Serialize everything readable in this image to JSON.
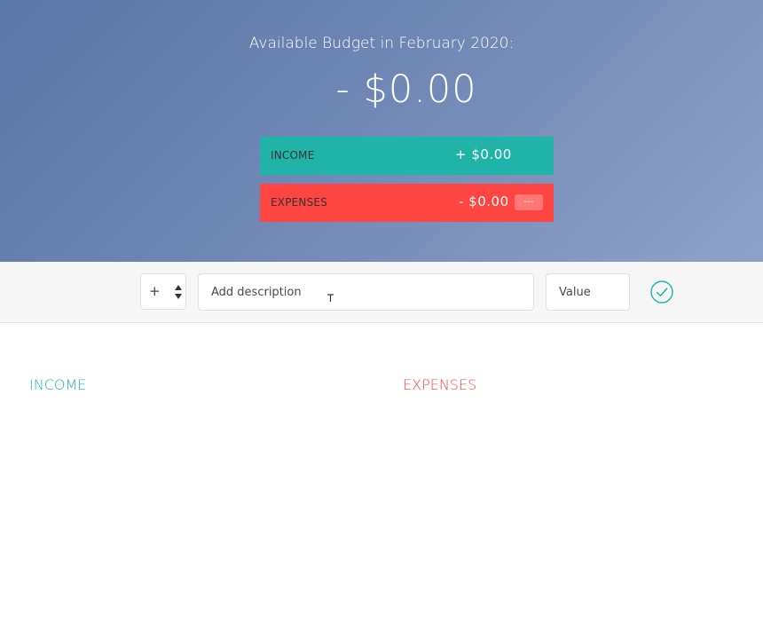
{
  "header": {
    "title": "Available Budget in February 2020:",
    "budget": "- $0.00"
  },
  "summary": {
    "income": {
      "label": "INCOME",
      "value": "+ $0.00"
    },
    "expenses": {
      "label": "EXPENSES",
      "value": "- $0.00",
      "percentage": "---"
    }
  },
  "add_form": {
    "type_value": "+",
    "description_placeholder": "Add description",
    "value_placeholder": "Value"
  },
  "lists": {
    "income_title": "INCOME",
    "expenses_title": "EXPENSES"
  },
  "colors": {
    "income": "#20b4a8",
    "expenses": "#ff4541",
    "header_gradient_start": "#5a75a8",
    "header_gradient_end": "#8ea1c8"
  }
}
